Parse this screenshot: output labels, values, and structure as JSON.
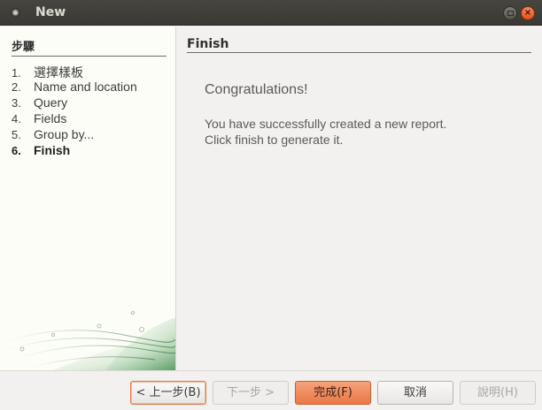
{
  "window": {
    "title": "New"
  },
  "steps": {
    "title": "步驟",
    "items": [
      {
        "num": "1.",
        "label": "選擇樣板"
      },
      {
        "num": "2.",
        "label": "Name and location"
      },
      {
        "num": "3.",
        "label": "Query"
      },
      {
        "num": "4.",
        "label": "Fields"
      },
      {
        "num": "5.",
        "label": "Group by..."
      },
      {
        "num": "6.",
        "label": "Finish"
      }
    ],
    "current_index": 5
  },
  "page": {
    "title": "Finish",
    "heading": "Congratulations!",
    "message_line1": "You have successfully created a new report.",
    "message_line2": "Click finish to generate it."
  },
  "buttons": {
    "back": "< 上一步(B)",
    "next": "下一步 >",
    "finish": "完成(F)",
    "cancel": "取消",
    "help": "說明(H)"
  },
  "colors": {
    "accent": "#ea7846",
    "titlebar": "#3f3e3a",
    "left_panel": "#fdfdf7"
  },
  "icons": {
    "window": "app-menu-icon",
    "maximize": "maximize-icon",
    "close": "close-icon"
  }
}
